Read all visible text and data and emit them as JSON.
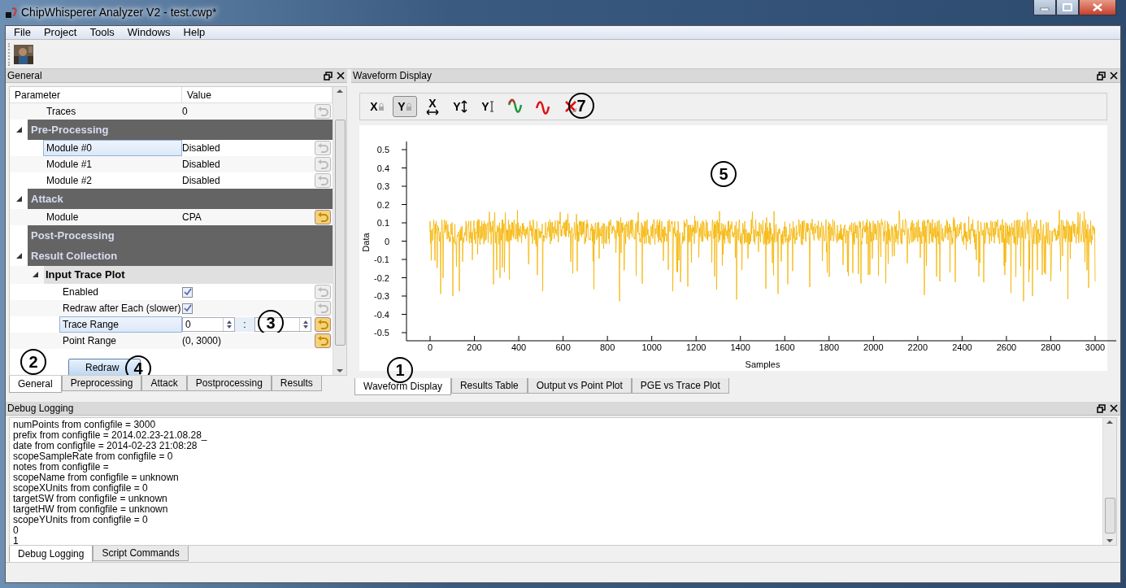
{
  "window": {
    "title": "ChipWhisperer Analyzer V2 - test.cwp*"
  },
  "menu": [
    "File",
    "Project",
    "Tools",
    "Windows",
    "Help"
  ],
  "left_dock": {
    "title": "General",
    "columns": [
      "Parameter",
      "Value"
    ],
    "tree": [
      {
        "kind": "param",
        "label": "Traces",
        "value": "0",
        "reset_active": false,
        "selected": false
      },
      {
        "kind": "group",
        "label": "Pre-Processing",
        "expanded": true,
        "children": [
          {
            "kind": "param",
            "label": "Module #0",
            "value": "Disabled",
            "reset_active": false,
            "selected": true
          },
          {
            "kind": "param",
            "label": "Module #1",
            "value": "Disabled",
            "reset_active": false,
            "selected": false
          },
          {
            "kind": "param",
            "label": "Module #2",
            "value": "Disabled",
            "reset_active": false,
            "selected": false
          }
        ]
      },
      {
        "kind": "group",
        "label": "Attack",
        "expanded": true,
        "children": [
          {
            "kind": "param",
            "label": "Module",
            "value": "CPA",
            "reset_active": true,
            "selected": false
          }
        ]
      },
      {
        "kind": "group",
        "label": "Post-Processing"
      },
      {
        "kind": "group",
        "label": "Result Collection",
        "expanded": true,
        "children": [
          {
            "kind": "subgroup",
            "label": "Input Trace Plot",
            "expanded": true,
            "children": [
              {
                "kind": "check",
                "label": "Enabled",
                "checked": true,
                "reset_active": false,
                "selected": false
              },
              {
                "kind": "check",
                "label": "Redraw after Each (slower)",
                "checked": true,
                "reset_active": false,
                "selected": false
              },
              {
                "kind": "range",
                "label": "Trace Range",
                "from": "0",
                "separator": ":",
                "reset_active": true,
                "selected": true,
                "callout": "3"
              },
              {
                "kind": "param",
                "label": "Point Range",
                "value": "(0, 3000)",
                "reset_active": true,
                "selected": false
              }
            ]
          }
        ]
      }
    ],
    "redraw_button": "Redraw",
    "redraw_callout": "4",
    "tabs": [
      {
        "label": "General",
        "selected": true
      },
      {
        "label": "Preprocessing",
        "selected": false
      },
      {
        "label": "Attack",
        "selected": false
      },
      {
        "label": "Postprocessing",
        "selected": false
      },
      {
        "label": "Results",
        "selected": false
      }
    ],
    "tabs_callout": "2"
  },
  "right_dock": {
    "title": "Waveform Display",
    "toolbar": [
      {
        "kind": "x-lock",
        "label": "X",
        "pressed": false
      },
      {
        "kind": "y-lock",
        "label": "Y",
        "pressed": true
      },
      {
        "kind": "x-fit",
        "label": "X",
        "pressed": false
      },
      {
        "kind": "y-fit",
        "label": "Y",
        "pressed": false
      },
      {
        "kind": "y-range",
        "label": "Y",
        "pressed": false
      },
      {
        "kind": "wave-color",
        "pressed": false
      },
      {
        "kind": "wave",
        "pressed": false
      },
      {
        "kind": "wave-clear",
        "pressed": false
      }
    ],
    "toolbar_callout": "7",
    "plot": {
      "ylabel": "Data",
      "xlabel": "Samples",
      "yticks": [
        "0.5",
        "0.4",
        "0.3",
        "0.2",
        "0.1",
        "0",
        "-0.1",
        "-0.2",
        "-0.3",
        "-0.4",
        "-0.5"
      ],
      "xticks": [
        "0",
        "200",
        "400",
        "600",
        "800",
        "1000",
        "1200",
        "1400",
        "1600",
        "1800",
        "2000",
        "2200",
        "2400",
        "2600",
        "2800",
        "3000"
      ],
      "callout": "5"
    },
    "tabs": [
      {
        "label": "Waveform Display",
        "selected": true
      },
      {
        "label": "Results Table",
        "selected": false
      },
      {
        "label": "Output vs Point Plot",
        "selected": false
      },
      {
        "label": "PGE vs Trace Plot",
        "selected": false
      }
    ],
    "tabs_callout": "1"
  },
  "bottom_dock": {
    "title": "Debug Logging",
    "lines": [
      "numPoints from configfile =  3000",
      "prefix from configfile =  2014.02.23-21.08.28_",
      "date from configfile =  2014-02-23 21:08:28",
      "scopeSampleRate from configfile =  0",
      "notes from configfile =",
      "scopeName from configfile =  unknown",
      "scopeXUnits from configfile =  0",
      "targetSW from configfile =  unknown",
      "targetHW from configfile =  unknown",
      "scopeYUnits from configfile =  0",
      "0",
      "1"
    ],
    "tabs": [
      {
        "label": "Debug Logging",
        "selected": true
      },
      {
        "label": "Script Commands",
        "selected": false
      }
    ]
  }
}
